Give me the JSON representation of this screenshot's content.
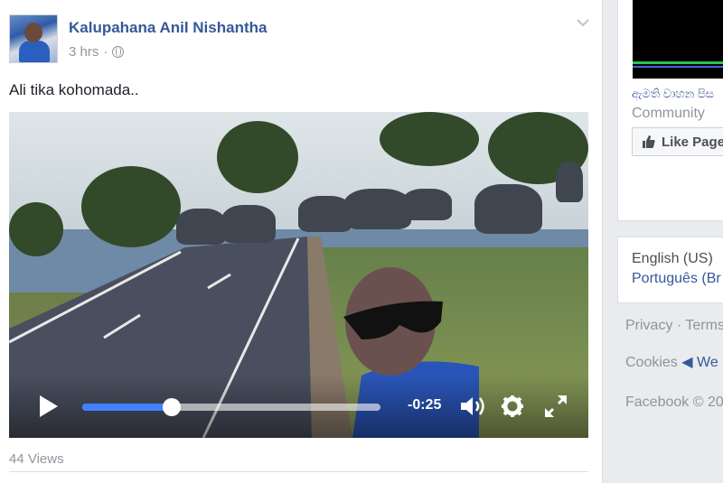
{
  "post": {
    "author": "Kalupahana Anil Nishantha",
    "time": "3 hrs",
    "separator": "·",
    "audience_icon": "globe-icon",
    "text": "Ali tika kohomada..",
    "views": "44 Views"
  },
  "video": {
    "time_remaining": "-0:25",
    "progress": 0.3,
    "icons": [
      "play-icon",
      "volume-icon",
      "settings-gear-icon",
      "fullscreen-icon"
    ],
    "accent_color": "#4080ff"
  },
  "sidebar": {
    "ad": {
      "title": "ඇමති වාහන පිස",
      "category": "Community",
      "like_label": "Like Page"
    },
    "languages": {
      "current": "English (US)",
      "other": "Português (Br"
    },
    "footer": {
      "privacy": "Privacy",
      "dot": "·",
      "terms": "Terms",
      "cookies": "Cookies",
      "more": "◀ We",
      "copyright": "Facebook © 20"
    }
  },
  "colors": {
    "link": "#365899",
    "meta": "#90949c",
    "page_bg": "#e9ebee"
  }
}
